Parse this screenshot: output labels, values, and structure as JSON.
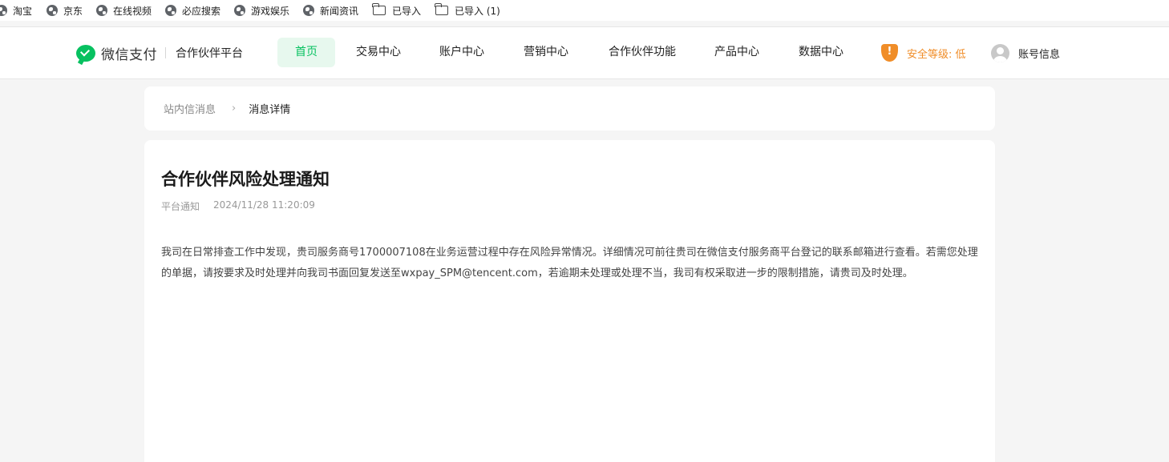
{
  "bookmarks": [
    {
      "label": "淘宝",
      "icon": "globe-icon"
    },
    {
      "label": "京东",
      "icon": "globe-icon"
    },
    {
      "label": "在线视频",
      "icon": "globe-icon"
    },
    {
      "label": "必应搜索",
      "icon": "globe-icon"
    },
    {
      "label": "游戏娱乐",
      "icon": "globe-icon"
    },
    {
      "label": "新闻资讯",
      "icon": "globe-icon"
    },
    {
      "label": "已导入",
      "icon": "folder-icon"
    },
    {
      "label": "已导入 (1)",
      "icon": "folder-icon"
    }
  ],
  "header": {
    "logo_text": "微信支付",
    "platform": "合作伙伴平台",
    "nav": [
      {
        "label": "首页",
        "active": true
      },
      {
        "label": "交易中心",
        "active": false
      },
      {
        "label": "账户中心",
        "active": false
      },
      {
        "label": "营销中心",
        "active": false
      },
      {
        "label": "合作伙伴功能",
        "active": false
      },
      {
        "label": "产品中心",
        "active": false
      },
      {
        "label": "数据中心",
        "active": false
      }
    ],
    "security": {
      "label": "安全等级: 低",
      "icon_glyph": "!",
      "color": "#f08d28"
    },
    "account": {
      "label": "账号信息"
    }
  },
  "breadcrumb": {
    "parent": "站内信消息",
    "separator": "›",
    "current": "消息详情"
  },
  "message": {
    "title": "合作伙伴风险处理通知",
    "category": "平台通知",
    "time": "2024/11/28 11:20:09",
    "body": "我司在日常排查工作中发现，贵司服务商号1700007108在业务运营过程中存在风险异常情况。详细情况可前往贵司在微信支付服务商平台登记的联系邮箱进行查看。若需您处理的单据，请按要求及时处理并向我司书面回复发送至wxpay_SPM@tencent.com，若逾期未处理或处理不当，我司有权采取进一步的限制措施，请贵司及时处理。"
  },
  "colors": {
    "brand_green": "#07c160",
    "active_nav_bg": "#e7f8ee",
    "warning_orange": "#f08d28",
    "page_bg": "#f5f5f5"
  }
}
